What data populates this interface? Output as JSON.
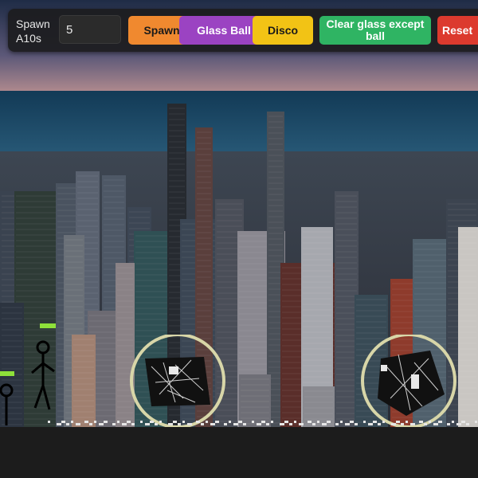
{
  "toolbar": {
    "spawn_label": "Spawn\nA10s",
    "spawn_count_value": "5",
    "buttons": [
      {
        "label": "Spawn",
        "color": "#f0892f"
      },
      {
        "label": "Glass Ball",
        "color": "#9b43c2"
      },
      {
        "label": "Disco",
        "color": "#f2c315"
      },
      {
        "label": "Clear glass except ball",
        "color": "#2fb463"
      },
      {
        "label": "Reset",
        "color": "#dc3a2e"
      }
    ]
  },
  "scene": {
    "background": "city-skyline-photo",
    "ground_color": "#1c1c1c",
    "ball_ring_color": "#d8d6a8",
    "health_bar_color": "#8ee03a"
  }
}
